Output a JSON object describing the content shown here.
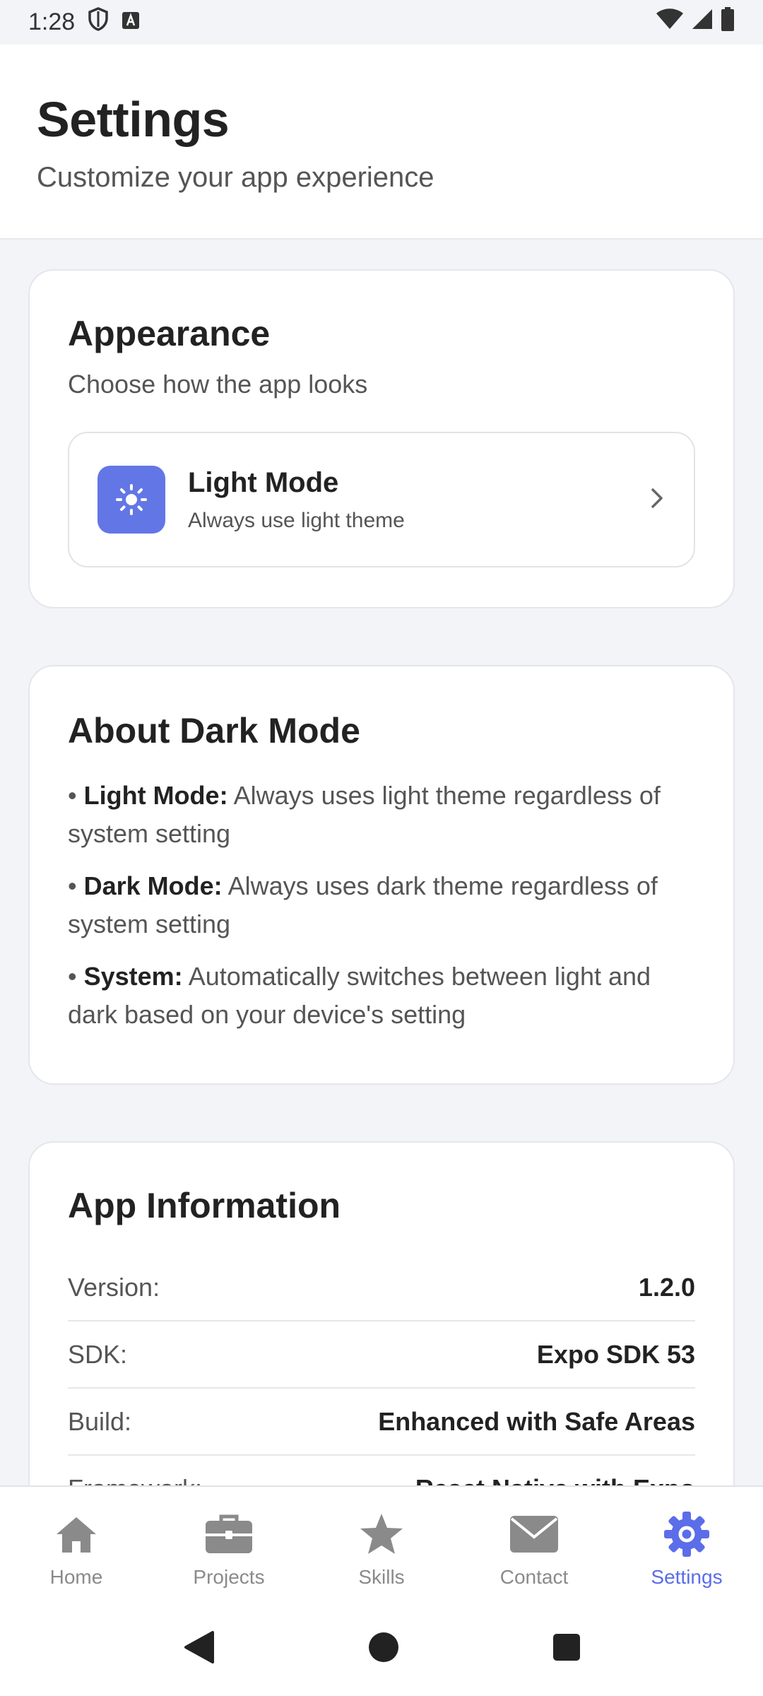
{
  "status_bar": {
    "time": "1:28"
  },
  "header": {
    "title": "Settings",
    "subtitle": "Customize your app experience"
  },
  "appearance": {
    "title": "Appearance",
    "subtitle": "Choose how the app looks",
    "option": {
      "name": "Light Mode",
      "description": "Always use light theme",
      "icon": "sun-icon",
      "icon_bg": "#6376e6"
    }
  },
  "about": {
    "title": "About Dark Mode",
    "items": [
      {
        "term": "Light Mode:",
        "text": " Always uses light theme regardless of system setting"
      },
      {
        "term": "Dark Mode:",
        "text": " Always uses dark theme regardless of system setting"
      },
      {
        "term": "System:",
        "text": " Automatically switches between light and dark based on your device's setting"
      }
    ]
  },
  "info": {
    "title": "App Information",
    "rows": [
      {
        "label": "Version:",
        "value": "1.2.0"
      },
      {
        "label": "SDK:",
        "value": "Expo SDK 53"
      },
      {
        "label": "Build:",
        "value": "Enhanced with Safe Areas"
      },
      {
        "label": "Framework:",
        "value": "React Native with Expo"
      }
    ]
  },
  "tabs": [
    {
      "label": "Home",
      "icon": "home-icon"
    },
    {
      "label": "Projects",
      "icon": "briefcase-icon"
    },
    {
      "label": "Skills",
      "icon": "star-icon"
    },
    {
      "label": "Contact",
      "icon": "envelope-icon"
    },
    {
      "label": "Settings",
      "icon": "gear-icon",
      "active": true
    }
  ],
  "colors": {
    "accent": "#5b6de8",
    "inactive_tab": "#8a8a8a",
    "background": "#f3f4f8"
  }
}
